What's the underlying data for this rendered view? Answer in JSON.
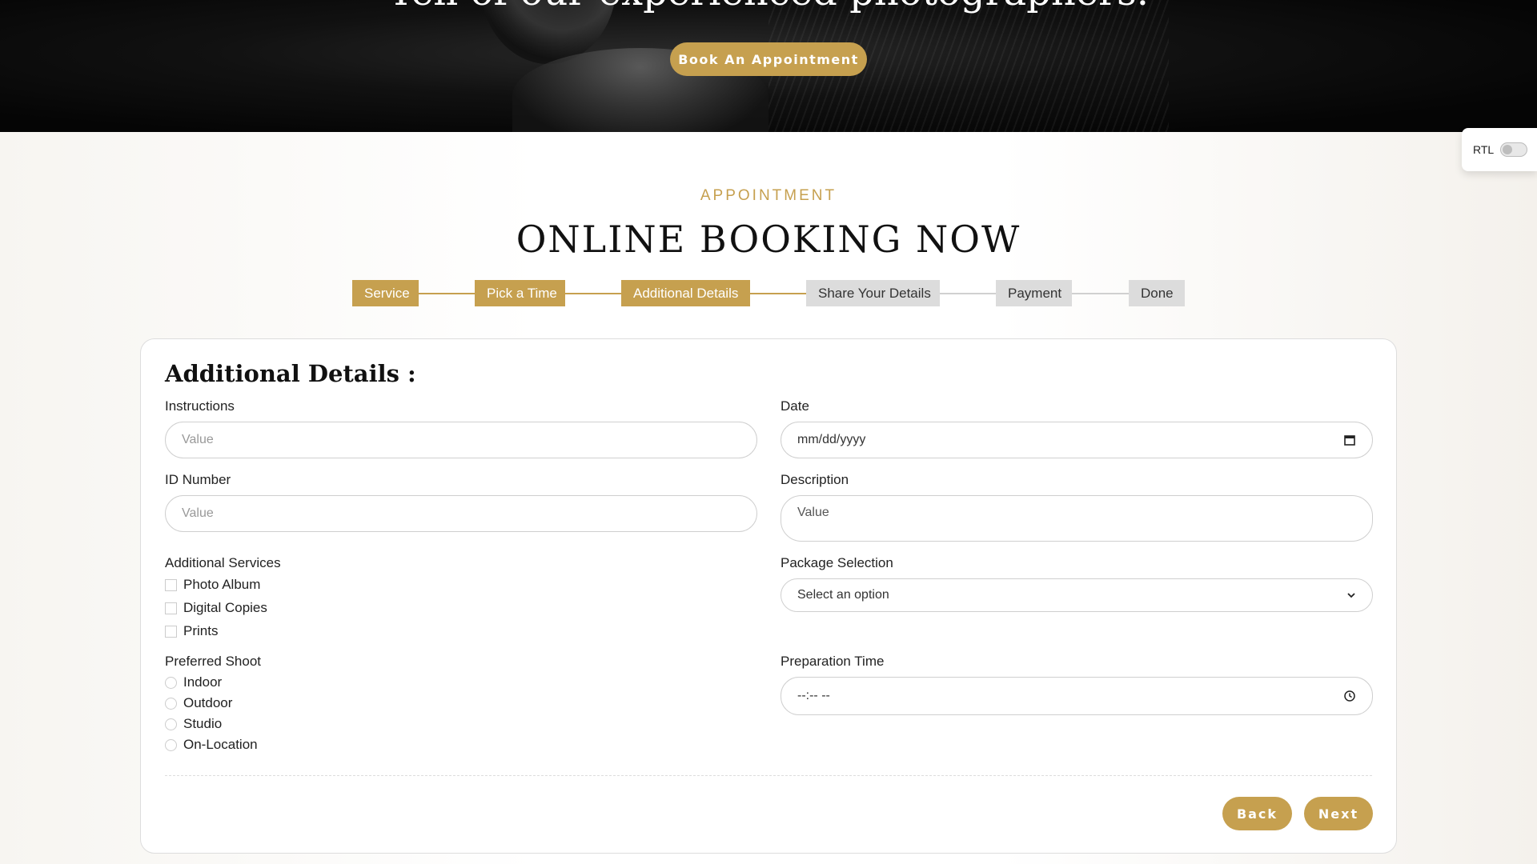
{
  "hero": {
    "headline": "Tell of our experienced photographers.",
    "cta_label": "Book An Appointment"
  },
  "rtl_toggle": {
    "label": "RTL",
    "enabled": false
  },
  "section": {
    "eyebrow": "APPOINTMENT",
    "title": "ONLINE BOOKING NOW"
  },
  "steps": [
    {
      "label": "Service",
      "state": "done"
    },
    {
      "label": "Pick a Time",
      "state": "done"
    },
    {
      "label": "Additional Details",
      "state": "current"
    },
    {
      "label": "Share Your Details",
      "state": "todo"
    },
    {
      "label": "Payment",
      "state": "todo"
    },
    {
      "label": "Done",
      "state": "todo"
    }
  ],
  "form": {
    "title": "Additional Details :",
    "instructions": {
      "label": "Instructions",
      "placeholder": "Value"
    },
    "date": {
      "label": "Date",
      "placeholder": "mm/dd/yyyy"
    },
    "id_number": {
      "label": "ID Number",
      "placeholder": "Value"
    },
    "description": {
      "label": "Description",
      "placeholder": "Value"
    },
    "additional_services": {
      "label": "Additional Services",
      "options": [
        "Photo Album",
        "Digital Copies",
        "Prints"
      ]
    },
    "package_selection": {
      "label": "Package Selection",
      "selected": "Select an option"
    },
    "preferred_shoot": {
      "label": "Preferred Shoot",
      "options": [
        "Indoor",
        "Outdoor",
        "Studio",
        "On-Location"
      ]
    },
    "preparation_time": {
      "label": "Preparation Time",
      "placeholder": "--:-- --"
    },
    "back_label": "Back",
    "next_label": "Next"
  },
  "colors": {
    "accent": "#c6a04f",
    "step_inactive": "#dcdcdc",
    "hero_bg": "#0b0b0b"
  },
  "icons": {
    "date": "calendar-icon",
    "select": "chevron-down-icon",
    "time": "clock-icon"
  }
}
